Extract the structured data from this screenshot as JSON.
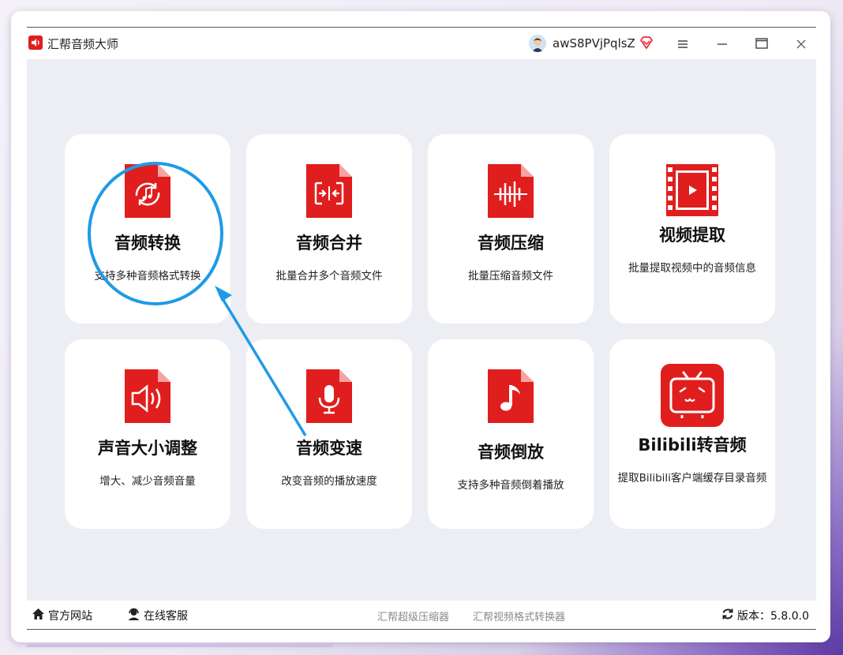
{
  "window": {
    "title": "汇帮音频大师",
    "user_name": "awS8PVjPqlsZ",
    "icons": {
      "logo": "speaker-icon",
      "avatar": "user-avatar",
      "vip": "diamond-icon",
      "menu": "hamburger-icon",
      "minimize": "minimize-icon",
      "maximize": "maximize-icon",
      "close": "close-icon"
    }
  },
  "colors": {
    "accent": "#e01e1e",
    "content_bg": "#eceef3",
    "annotation": "#1e9be6"
  },
  "tools": [
    {
      "title": "音频转换",
      "desc": "支持多种音频格式转换",
      "icon": "audio-convert-icon"
    },
    {
      "title": "音频合并",
      "desc": "批量合并多个音频文件",
      "icon": "audio-merge-icon"
    },
    {
      "title": "音频压缩",
      "desc": "批量压缩音频文件",
      "icon": "audio-compress-icon"
    },
    {
      "title": "视频提取",
      "desc": "批量提取视频中的音频信息",
      "icon": "video-extract-icon"
    },
    {
      "title": "声音大小调整",
      "desc": "增大、减少音频音量",
      "icon": "volume-icon"
    },
    {
      "title": "音频变速",
      "desc": "改变音频的播放速度",
      "icon": "microphone-icon"
    },
    {
      "title": "音频倒放",
      "desc": "支持多种音频倒着播放",
      "icon": "music-note-icon"
    },
    {
      "title": "Bilibili转音频",
      "desc": "提取Bilibili客户端缓存目录音频",
      "icon": "bilibili-tv-icon"
    }
  ],
  "footer": {
    "home": "官方网站",
    "service": "在线客服",
    "link1": "汇帮超级压缩器",
    "link2": "汇帮视频格式转换器",
    "version": "版本：5.8.0.0"
  }
}
